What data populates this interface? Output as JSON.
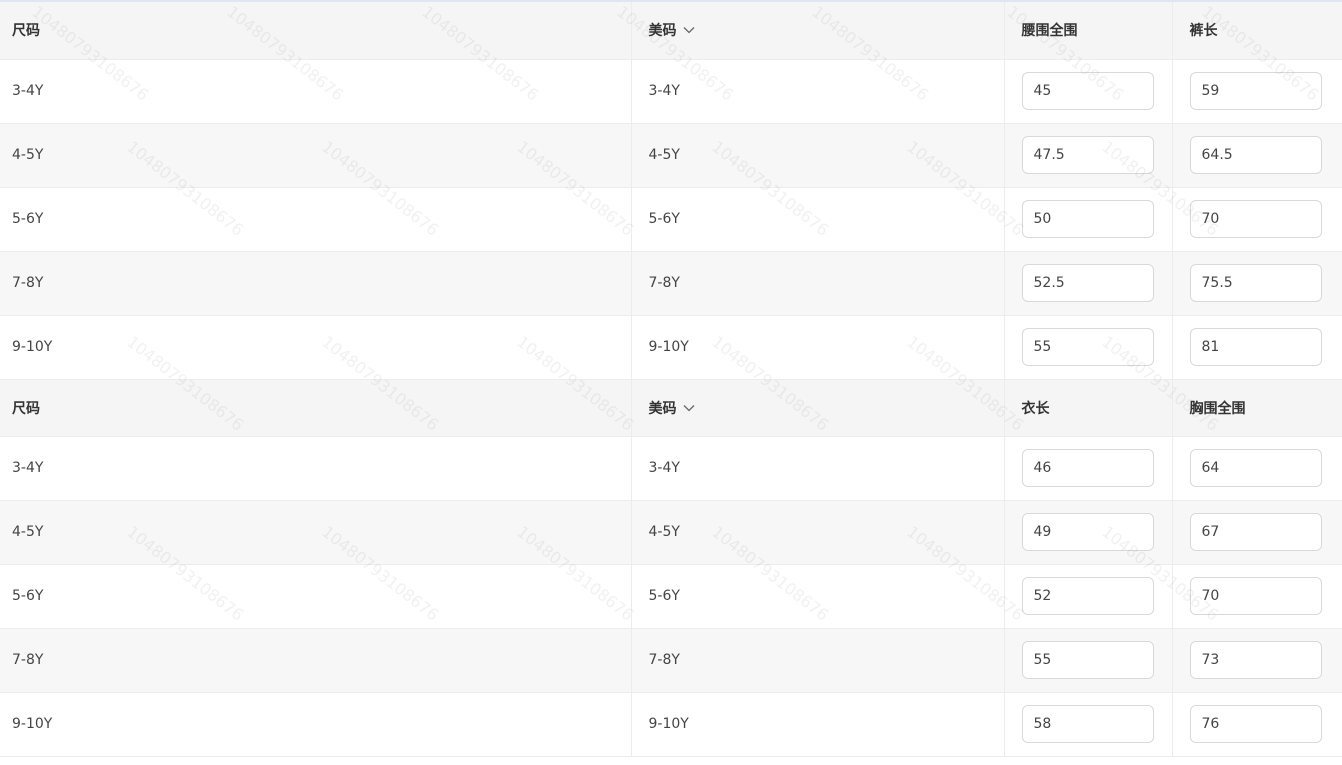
{
  "watermark": {
    "text": "10480793108676"
  },
  "sections": [
    {
      "headers": {
        "size": "尺码",
        "us_size": "美码",
        "measure_a": "腰围全围",
        "measure_b": "裤长"
      },
      "rows": [
        {
          "size": "3-4Y",
          "us_size": "3-4Y",
          "a": "45",
          "b": "59"
        },
        {
          "size": "4-5Y",
          "us_size": "4-5Y",
          "a": "47.5",
          "b": "64.5"
        },
        {
          "size": "5-6Y",
          "us_size": "5-6Y",
          "a": "50",
          "b": "70"
        },
        {
          "size": "7-8Y",
          "us_size": "7-8Y",
          "a": "52.5",
          "b": "75.5"
        },
        {
          "size": "9-10Y",
          "us_size": "9-10Y",
          "a": "55",
          "b": "81"
        }
      ]
    },
    {
      "headers": {
        "size": "尺码",
        "us_size": "美码",
        "measure_a": "衣长",
        "measure_b": "胸围全围"
      },
      "rows": [
        {
          "size": "3-4Y",
          "us_size": "3-4Y",
          "a": "46",
          "b": "64"
        },
        {
          "size": "4-5Y",
          "us_size": "4-5Y",
          "a": "49",
          "b": "67"
        },
        {
          "size": "5-6Y",
          "us_size": "5-6Y",
          "a": "52",
          "b": "70"
        },
        {
          "size": "7-8Y",
          "us_size": "7-8Y",
          "a": "55",
          "b": "73"
        },
        {
          "size": "9-10Y",
          "us_size": "9-10Y",
          "a": "58",
          "b": "76"
        }
      ]
    }
  ]
}
